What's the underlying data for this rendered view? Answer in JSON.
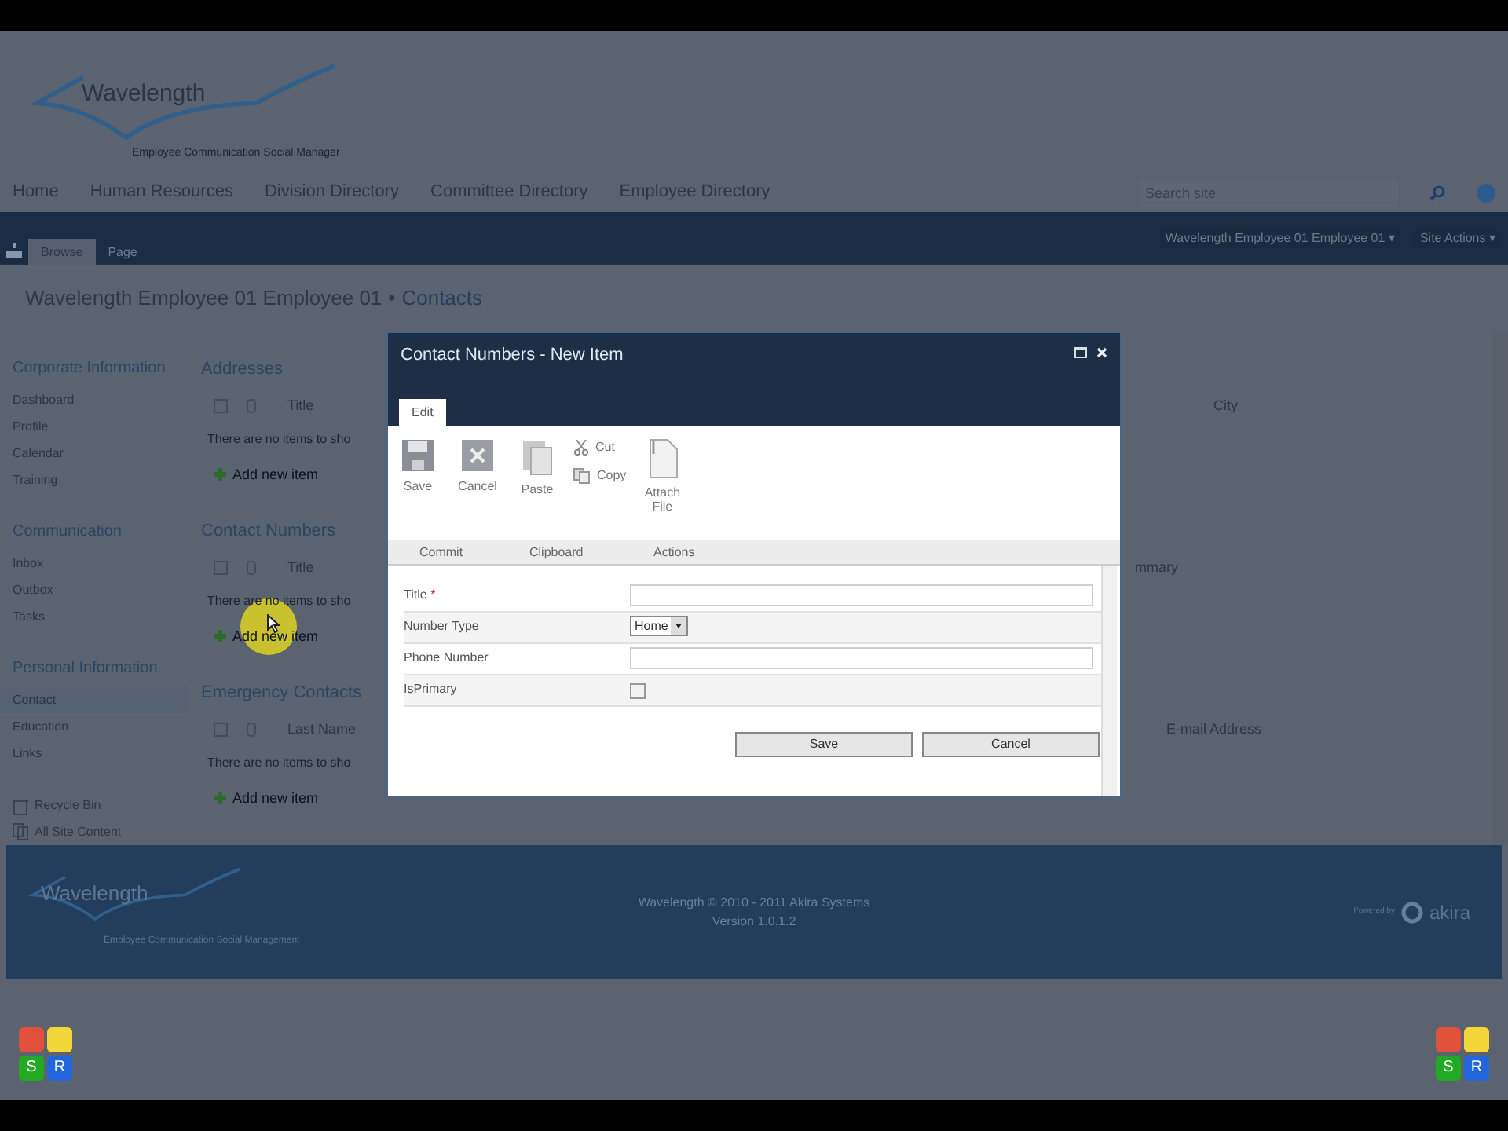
{
  "header": {
    "logo": "Wavelength",
    "tagline": "Employee Communication Social Manager",
    "search": {
      "placeholder": "Search site"
    }
  },
  "nav": [
    {
      "label": "Home"
    },
    {
      "label": "Human Resources"
    },
    {
      "label": "Division Directory"
    },
    {
      "label": "Committee Directory"
    },
    {
      "label": "Employee Directory"
    }
  ],
  "ribbon": {
    "caret": "▾",
    "tabs": [
      {
        "label": "Browse",
        "selected": true
      },
      {
        "label": "Page",
        "selected": false
      }
    ],
    "user": "Wavelength Employee 01 Employee 01",
    "site_actions": "Site Actions"
  },
  "breadcrumb": {
    "site": "Wavelength Employee 01 Employee 01",
    "separator": "•",
    "page": "Contacts"
  },
  "sidebar": {
    "groups": [
      {
        "title": "Corporate Information",
        "items": [
          {
            "label": "Dashboard",
            "selected": false
          },
          {
            "label": "Profile",
            "selected": false
          },
          {
            "label": "Calendar",
            "selected": false
          },
          {
            "label": "Training",
            "selected": false
          }
        ]
      },
      {
        "title": "Communication",
        "items": [
          {
            "label": "Inbox",
            "selected": false
          },
          {
            "label": "Outbox",
            "selected": false
          },
          {
            "label": "Tasks",
            "selected": false
          }
        ]
      },
      {
        "title": "Personal Information",
        "items": [
          {
            "label": "Contact",
            "selected": true
          },
          {
            "label": "Education",
            "selected": false
          },
          {
            "label": "Links",
            "selected": false
          }
        ]
      }
    ],
    "footer_links": [
      {
        "label": "Recycle Bin",
        "kind": "bin"
      },
      {
        "label": "All Site Content",
        "kind": "content"
      }
    ]
  },
  "sections": [
    {
      "title": "Addresses",
      "checked": false,
      "column": "Title",
      "empty": "There are no items to sho",
      "add": "Add new item",
      "right_column": "City"
    },
    {
      "title": "Contact Numbers",
      "checked": false,
      "column": "Title",
      "empty": "There are no items to sho",
      "add": "Add new item",
      "right_column": "mmary"
    },
    {
      "title": "Emergency Contacts",
      "checked": false,
      "column": "Last Name",
      "empty": "There are no items to sho",
      "add": "Add new item",
      "right_column": "E-mail Address"
    }
  ],
  "dialog": {
    "title": "Contact Numbers - New Item",
    "tab": {
      "label": "Edit",
      "selected": true
    },
    "ribbon_groups": [
      {
        "label": "Commit",
        "buttons": [
          {
            "label": "Save",
            "kind": "save"
          },
          {
            "label": "Cancel",
            "kind": "cancel"
          }
        ]
      },
      {
        "label": "Clipboard",
        "buttons": [
          {
            "label": "Paste",
            "kind": "paste"
          }
        ],
        "small_buttons": [
          {
            "label": "Cut",
            "kind": "cut"
          },
          {
            "label": "Copy",
            "kind": "copy"
          }
        ]
      },
      {
        "label": "Actions",
        "buttons": [
          {
            "label": "Attach File",
            "kind": "attach"
          }
        ]
      }
    ],
    "fields": [
      {
        "label": "Title",
        "required": true,
        "kind": "text"
      },
      {
        "label": "Number Type",
        "required": false,
        "kind": "select",
        "value": "Home"
      },
      {
        "label": "Phone Number",
        "required": false,
        "kind": "text"
      },
      {
        "label": "IsPrimary",
        "required": false,
        "kind": "checkbox",
        "checked": false
      }
    ],
    "required_mark": "*",
    "buttons": [
      "Save",
      "Cancel"
    ]
  },
  "footer": {
    "logo": "Wavelength",
    "tagline": "Employee Communication Social Management",
    "copyright": "Wavelength © 2010 - 2011 Akira Systems",
    "version": "Version 1.0.1.2",
    "powered": "Powered by",
    "brand": "akira"
  },
  "corner_badges": [
    {
      "badges": [
        {
          "letter": "S",
          "color": "#22aa22"
        },
        {
          "letter": "R",
          "color": "#2266dd"
        }
      ]
    },
    {
      "badges": [
        {
          "letter": "S",
          "color": "#22aa22"
        },
        {
          "letter": "R",
          "color": "#2266dd"
        }
      ]
    }
  ]
}
